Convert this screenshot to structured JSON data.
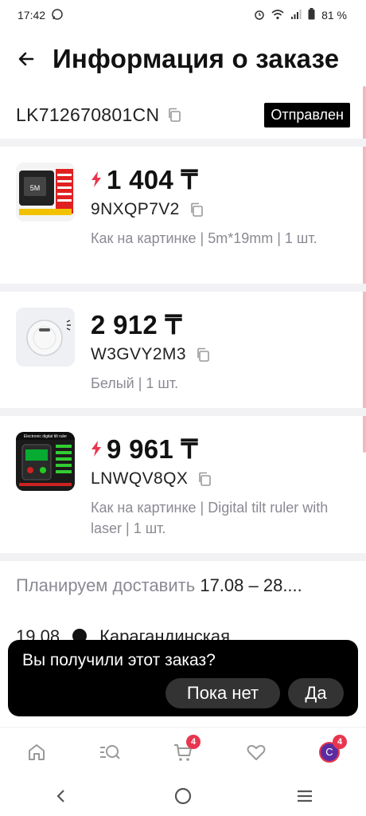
{
  "status_bar": {
    "time": "17:42",
    "battery": "81 %"
  },
  "header": {
    "title": "Информация о заказе"
  },
  "order": {
    "tracking_number": "LK712670801CN",
    "status": "Отправлен"
  },
  "items": [
    {
      "price": "1 404 ₸",
      "sku": "9NXQP7V2",
      "variant": "Как на картинке | 5m*19mm | 1 шт.",
      "promo": true,
      "thumb_label": "5M"
    },
    {
      "price": "2 912 ₸",
      "sku": "W3GVY2M3",
      "variant": "Белый | 1 шт.",
      "promo": false
    },
    {
      "price": "9 961 ₸",
      "sku": "LNWQV8QX",
      "variant": "Как на картинке | Digital tilt ruler with laser | 1 шт.",
      "promo": true,
      "thumb_label": "Electronic digital tilt ruler"
    }
  ],
  "delivery": {
    "label": "Планируем доставить",
    "range": "17.08 – 28...."
  },
  "timeline": {
    "date": "19.08",
    "location": "Карагандинская"
  },
  "snackbar": {
    "message": "Вы получили этот заказ?",
    "no_label": "Пока нет",
    "yes_label": "Да"
  },
  "bottom_nav": {
    "cart_badge": "4",
    "profile_badge": "4",
    "avatar_letter": "C"
  },
  "colors": {
    "accent": "#e8364f",
    "badge_bg": "#000000"
  }
}
